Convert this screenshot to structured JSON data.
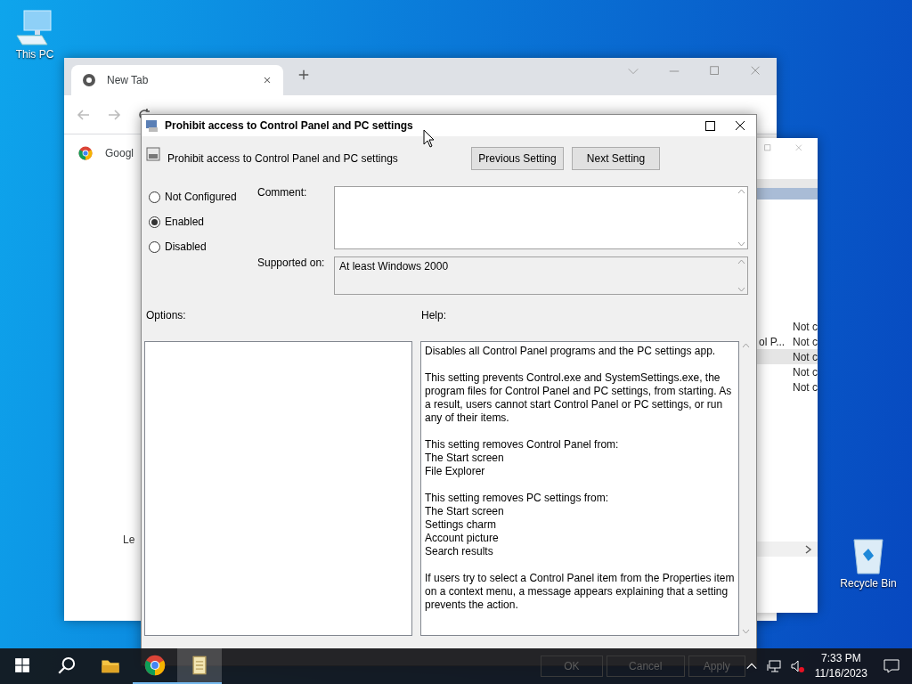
{
  "desktop_icons": [
    {
      "label": "This PC",
      "kind": "computer"
    },
    {
      "label": "Recycle Bin",
      "kind": "recycle"
    }
  ],
  "browser": {
    "tab_title": "New Tab",
    "bookmark": "Googl",
    "side_text": "Le"
  },
  "background_window": {
    "rows": [
      {
        "column_1": "",
        "column_2": "Not c",
        "selected": false
      },
      {
        "column_1": "ol P...",
        "column_2": "Not c",
        "selected": false
      },
      {
        "column_1": "",
        "column_2": "Not c",
        "selected": true
      },
      {
        "column_1": "",
        "column_2": "Not c",
        "selected": false
      },
      {
        "column_1": "",
        "column_2": "Not c",
        "selected": false
      }
    ]
  },
  "dialog": {
    "title": "Prohibit access to Control Panel and PC settings",
    "setting_name": "Prohibit access to Control Panel and PC settings",
    "buttons": [
      "Previous Setting",
      "Next Setting"
    ],
    "states": [
      {
        "label": "Not Configured",
        "selected": false
      },
      {
        "label": "Enabled",
        "selected": true
      },
      {
        "label": "Disabled",
        "selected": false
      }
    ],
    "comment_label": "Comment:",
    "supported_label": "Supported on:",
    "supported": "At least Windows 2000",
    "options_label": "Options:",
    "help_label": "Help:",
    "help": [
      [
        "Disables all Control Panel programs and the PC settings app."
      ],
      [
        "This setting prevents Control.exe and SystemSettings.exe, the program files for Control Panel and PC settings, from starting. As a result, users cannot start Control Panel or PC settings, or run any of their items."
      ],
      [
        "This setting removes Control Panel from:",
        "The Start screen",
        "File Explorer"
      ],
      [
        "This setting removes PC settings from:",
        "The Start screen",
        "Settings charm",
        "Account picture",
        "Search results"
      ],
      [
        "If users try to select a Control Panel item from the Properties item on a context menu, a message appears explaining that a setting prevents the action."
      ]
    ]
  },
  "taskbar": {
    "apps": [
      {
        "kind": "explorer",
        "running": false,
        "selected": false
      },
      {
        "kind": "chrome",
        "running": true,
        "selected": false
      },
      {
        "kind": "document",
        "running": true,
        "selected": true
      }
    ],
    "ghost_buttons": [
      "OK",
      "Cancel",
      "Apply"
    ],
    "time": "7:33 PM",
    "date": "11/16/2023"
  }
}
